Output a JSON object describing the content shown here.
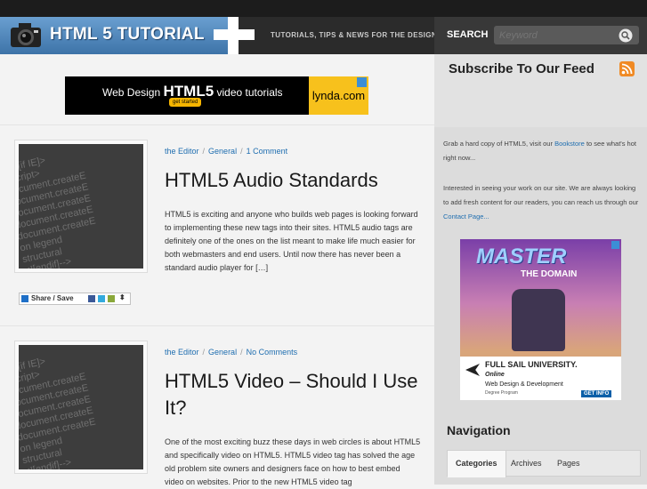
{
  "header": {
    "logo_text": "HTML 5 TUTORIAL",
    "tagline": "TUTORIALS, TIPS & NEWS FOR THE DESIGNER",
    "search_label": "SEARCH",
    "search_placeholder": "Keyword",
    "colors": {
      "logo_bg": "#4f87bd",
      "header_bg": "#2b2b2b"
    }
  },
  "banner_ad": {
    "text_prefix": "Web Design",
    "text_bold": "HTML5",
    "text_suffix": "video tutorials",
    "button": "get started",
    "brand": "lynda.com"
  },
  "posts": [
    {
      "author": "the Editor",
      "category": "General",
      "comments": "1 Comment",
      "title": "HTML5 Audio Standards",
      "excerpt": "HTML5 is exciting and anyone who builds web pages is looking forward to implementing these new tags into their sites. HTML5 audio tags are definitely one of the ones on the list meant to make life much easier for both webmasters and end users. Until now there has never been a standard audio player for […]"
    },
    {
      "author": "the Editor",
      "category": "General",
      "comments": "No Comments",
      "title": "HTML5 Video – Should I Use It?",
      "excerpt": "One of the most exciting buzz these days in web circles is about HTML5 and specifically video on HTML5. HTML5 video tag has solved the age old problem site owners and designers face on how to best embed video on websites. Prior to the new HTML5 video tag"
    }
  ],
  "thumbnail_code": "<!--[if IE]>\n<script>\ndocument.createE\ndocument.createE\ndocument.createE\ndocument.createE\ndocument.createE\non legend\nstructural\n<![endif]-->",
  "share": {
    "label": "Share / Save"
  },
  "sidebar": {
    "subscribe_title": "Subscribe To Our Feed",
    "text1_prefix": "Grab a hard copy of HTML5, visit our",
    "text1_link": "Bookstore",
    "text1_suffix": "to see what's hot right now...",
    "text2_prefix": "Interested in seeing your work on our site. We are always looking to add fresh content for our readers, you can reach us through our",
    "text2_link": "Contact Page...",
    "ad": {
      "title": "MASTER",
      "subtitle": "THE DOMAIN",
      "school": "FULL SAIL UNIVERSITY.",
      "online": "Online",
      "program": "Web Design & Development",
      "degree": "Degree Program",
      "cta": "GET INFO"
    },
    "nav_title": "Navigation",
    "tabs": [
      "Categories",
      "Archives",
      "Pages"
    ]
  }
}
